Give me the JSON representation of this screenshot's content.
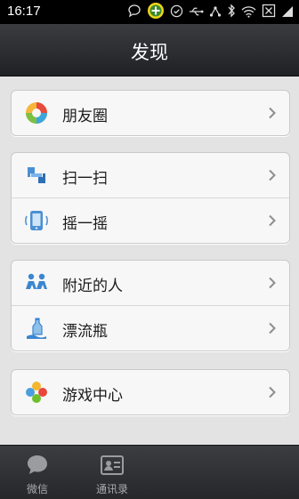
{
  "status_bar": {
    "time": "16:17",
    "icons": [
      "chat-bubble-icon",
      "plus-badge-icon",
      "check-circle-icon",
      "usb-icon",
      "share-icon",
      "bluetooth-icon",
      "wifi-icon",
      "no-sim-icon",
      "signal-icon"
    ]
  },
  "header": {
    "title": "发现"
  },
  "groups": [
    {
      "items": [
        {
          "label": "朋友圈",
          "icon": "moments-icon"
        }
      ]
    },
    {
      "items": [
        {
          "label": "扫一扫",
          "icon": "scan-icon"
        },
        {
          "label": "摇一摇",
          "icon": "shake-icon"
        }
      ]
    },
    {
      "items": [
        {
          "label": "附近的人",
          "icon": "nearby-people-icon"
        },
        {
          "label": "漂流瓶",
          "icon": "drift-bottle-icon"
        }
      ]
    },
    {
      "items": [
        {
          "label": "游戏中心",
          "icon": "game-center-icon"
        }
      ]
    }
  ],
  "tabbar": {
    "tabs": [
      {
        "label": "微信",
        "icon": "chat-bubble-icon"
      },
      {
        "label": "通讯录",
        "icon": "contacts-icon"
      }
    ]
  },
  "colors": {
    "accent_green": "#6fbf2d",
    "header_bg": "#2b2d30",
    "page_bg": "#e3e3e3"
  }
}
